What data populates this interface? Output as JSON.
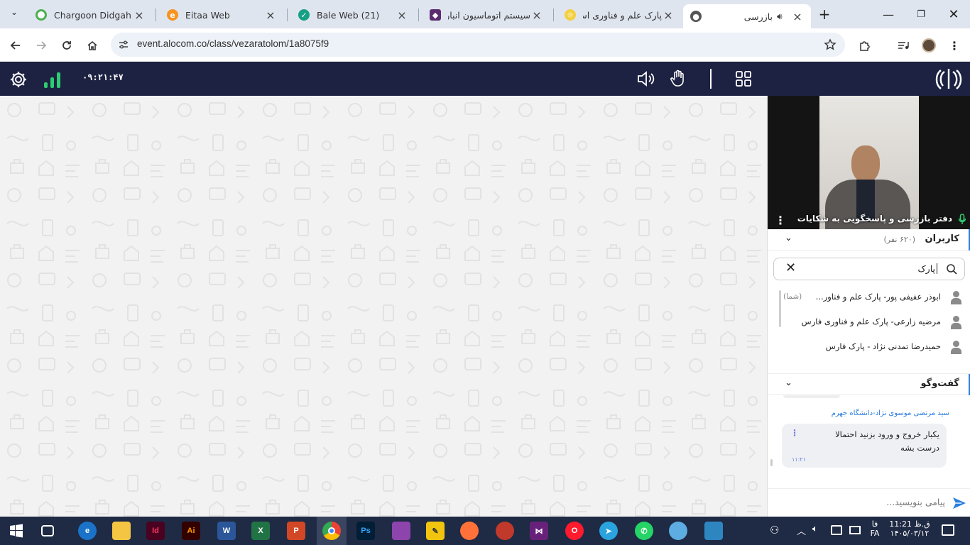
{
  "browser": {
    "tabs": [
      {
        "label": "Chargoon Didgah",
        "icon": "circle-icon",
        "color": "#4caf50"
      },
      {
        "label": "Eitaa Web",
        "icon": "eitaa-icon",
        "color": "#f7931e"
      },
      {
        "label": "Bale Web (21)",
        "icon": "bale-icon",
        "color": "#16a085"
      },
      {
        "label": "سیستم اتوماسیون انبار",
        "icon": "app-icon",
        "color": "#5b2c6f"
      },
      {
        "label": "پارک علم و فناوری اس...",
        "icon": "sun-icon",
        "color": "#f4d03f"
      },
      {
        "label": "بازرسی",
        "icon": "globe-icon",
        "color": "#555555"
      }
    ],
    "new_tab": "+",
    "url": "event.alocom.co/class/vezaratolom/1a8075f9"
  },
  "appbar": {
    "clock": "۰۹:۲۱:۴۷"
  },
  "video": {
    "name": "دفتر بازرسی و پاسخگویی به شکایات"
  },
  "users": {
    "title": "کاربران",
    "count": "(۶۲۰ نفر)",
    "search_value": "پارک",
    "items": [
      {
        "name": "ابوذر عفیفی پور- پارک علم و فناور...",
        "tag": "(شما)"
      },
      {
        "name": "مرضیه زارعی- پارک علم و فناوری فارس",
        "tag": ""
      },
      {
        "name": "حمیدرضا تمدنی نژاد - پارک فارس",
        "tag": ""
      }
    ]
  },
  "chat": {
    "title": "گفت‌وگو",
    "sender": "سید مرتضی موسوی نژاد-دانشگاه جهرم",
    "message_line1": "یکبار خروج و ورود بزنید احتمالا",
    "message_line2": "درست بشه",
    "time": "۱۱:۲۱",
    "input_placeholder": "پیامی بنویسید..."
  },
  "taskbar": {
    "lang_top": "فا",
    "lang_bottom": "FA",
    "time": "ق.ظ 11:21",
    "date": "۱۴۰۵/۰۳/۱۲",
    "apps": [
      "windows",
      "task-view",
      "edge",
      "explorer",
      "indesign",
      "illustrator",
      "word",
      "excel",
      "powerpoint",
      "chrome",
      "photoshop",
      "winrar",
      "tool",
      "firefox",
      "app",
      "visual-studio",
      "opera",
      "telegram",
      "whatsapp",
      "app2",
      "app3"
    ]
  },
  "colors": {
    "appbar_bg": "#1d2142",
    "accent": "#2a7de1",
    "signal_green": "#2ecc71"
  }
}
